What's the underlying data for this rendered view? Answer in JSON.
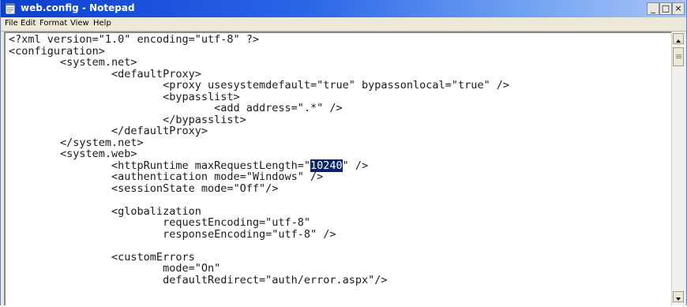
{
  "window": {
    "title": "web.config - Notepad",
    "controls": {
      "minimize": "_",
      "maximize": "□",
      "close": "×"
    }
  },
  "menu": [
    "File",
    "Edit",
    "Format",
    "View",
    "Help"
  ],
  "editor": {
    "lines": [
      {
        "text": "<?xml version=\"1.0\" encoding=\"utf-8\" ?>"
      },
      {
        "text": "<configuration>"
      },
      {
        "text": "        <system.net>"
      },
      {
        "text": "                <defaultProxy>"
      },
      {
        "text": "                        <proxy usesystemdefault=\"true\" bypassonlocal=\"true\" />"
      },
      {
        "text": "                        <bypasslist>"
      },
      {
        "text": "                                <add address=\".*\" />"
      },
      {
        "text": "                        </bypasslist>"
      },
      {
        "text": "                </defaultProxy>"
      },
      {
        "text": "        </system.net>"
      },
      {
        "text": "        <system.web>"
      },
      {
        "before": "                <httpRuntime maxRequestLength=\"",
        "selected": "10240",
        "after": "\" />"
      },
      {
        "text": "                <authentication mode=\"Windows\" />"
      },
      {
        "text": "                <sessionState mode=\"Off\"/>"
      },
      {
        "text": ""
      },
      {
        "text": "                <globalization"
      },
      {
        "text": "                        requestEncoding=\"utf-8\""
      },
      {
        "text": "                        responseEncoding=\"utf-8\" />"
      },
      {
        "text": ""
      },
      {
        "text": "                <customErrors"
      },
      {
        "text": "                        mode=\"On\""
      },
      {
        "text": "                        defaultRedirect=\"auth/error.aspx\"/>"
      }
    ]
  },
  "colors": {
    "titlebar_start": "#0b3fd0",
    "titlebar_end": "#a9c6f7",
    "selection_bg": "#0a246a",
    "selection_fg": "#ffffff"
  },
  "icons": {
    "app": "notepad-icon",
    "scroll_up": "arrow-up-icon",
    "scroll_down": "arrow-down-icon"
  }
}
